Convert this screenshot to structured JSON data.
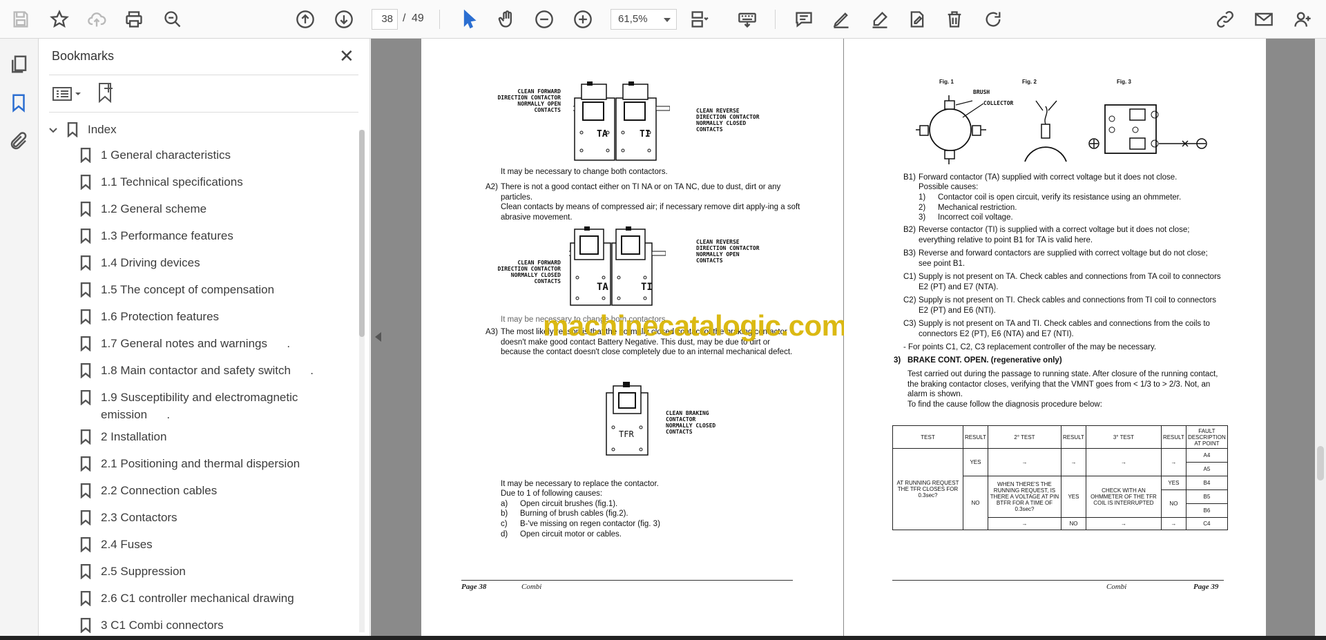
{
  "toolbar": {
    "page_current": "38",
    "page_separator": "/",
    "page_total": "49",
    "zoom": "61,5%"
  },
  "bookmarks": {
    "title": "Bookmarks",
    "root": "Index",
    "items": [
      {
        "label": "1 General characteristics"
      },
      {
        "label": "1.1 Technical specifications"
      },
      {
        "label": "1.2 General scheme"
      },
      {
        "label": "1.3 Performance features"
      },
      {
        "label": "1.4 Driving devices"
      },
      {
        "label": "1.5 The concept of compensation"
      },
      {
        "label": "1.6 Protection features"
      },
      {
        "label": "1.7 General notes and warnings      ."
      },
      {
        "label": "1.8 Main contactor and safety switch      ."
      },
      {
        "label": "1.9 Susceptibility and electromagnetic emission      ."
      },
      {
        "label": "2 Installation"
      },
      {
        "label": "2.1 Positioning and thermal dispersion"
      },
      {
        "label": "2.2 Connection cables"
      },
      {
        "label": "2.3 Contactors"
      },
      {
        "label": "2.4 Fuses"
      },
      {
        "label": "2.5 Suppression"
      },
      {
        "label": "2.6 C1 controller mechanical drawing"
      },
      {
        "label": "3 C1 Combi connectors"
      }
    ]
  },
  "left_page": {
    "diag1_left": "CLEAN FORWARD\nDIRECTION CONTACTOR\nNORMALLY OPEN\nCONTACTS",
    "diag1_right": "CLEAN REVERSE\nDIRECTION CONTACTOR\nNORMALLY CLOSED\nCONTACTS",
    "diag1_ta": "TA",
    "diag1_ti": "TI",
    "p1": "It may be necessary to change both contactors.",
    "a2_label": "A2)",
    "a2_text": "There is not a good contact either on TI NA or on TA NC, due to dust, dirt or any particles.",
    "a2_text2": "Clean contacts by means of compressed air; if necessary remove dirt apply-ing a soft abrasive movement.",
    "diag2_left": "CLEAN FORWARD\nDIRECTION CONTACTOR\nNORMALLY CLOSED\nCONTACTS",
    "diag2_right": "CLEAN REVERSE\nDIRECTION CONTACTOR\nNORMALLY OPEN\nCONTACTS",
    "p2": "It may be necessary to change both contactors.",
    "a3_label": "A3)",
    "a3_text": "The most likely reason is that the normally closed contact of the braking contactor doesn't make good contact Battery Negative. This dust, may be due to dirt or because the contact doesn't close completely due to an internal mechanical defect.",
    "diag3_label": "CLEAN BRAKING\nCONTACTOR\nNORMALLY CLOSED\nCONTACTS",
    "diag3_tfr": "TFR",
    "p3": "It may be necessary to replace the contactor.",
    "p4": "Due to 1 of following causes:",
    "causes": [
      {
        "k": "a)",
        "t": "Open circuit brushes (fig.1)."
      },
      {
        "k": "b)",
        "t": "Burning of brush cables (fig.2)."
      },
      {
        "k": "c)",
        "t": "B-'ve missing on regen contactor (fig. 3)"
      },
      {
        "k": "d)",
        "t": "Open circuit motor or cables."
      }
    ],
    "footer_page": "Page 38",
    "footer_title": "Combi"
  },
  "right_page": {
    "fig1": "Fig. 1",
    "fig2": "Fig. 2",
    "fig3": "Fig. 3",
    "brush": "BRUSH",
    "collector": "COLLECTOR",
    "b1_label": "B1)",
    "b1_text": "Forward contactor (TA) supplied with correct voltage but it does not close.",
    "b1_causes_title": "Possible causes:",
    "b1_causes": [
      {
        "k": "1)",
        "t": "Contactor coil is open circuit, verify its resistance using an ohmmeter."
      },
      {
        "k": "2)",
        "t": "Mechanical restriction."
      },
      {
        "k": "3)",
        "t": "Incorrect coil voltage."
      }
    ],
    "b2_label": "B2)",
    "b2_text": "Reverse contactor (TI) is supplied with a correct voltage but it does not close; everything relative to point B1 for TA is valid here.",
    "b3_label": "B3)",
    "b3_text": "Reverse and forward contactors are supplied with correct voltage but do not close; see point B1.",
    "c1_label": "C1)",
    "c1_text": "Supply is not present on TA. Check cables and connections from TA coil to connectors E2 (PT) and E7 (NTA).",
    "c2_label": "C2)",
    "c2_text": "Supply is not present on TI. Check cables and connections from TI coil to connectors E2 (PT) and E6 (NTI).",
    "c3_label": "C3)",
    "c3_text": "Supply is not present on TA and TI. Check cables and connections from the coils to connectors E2 (PT), E6 (NTA) and E7 (NTI).",
    "c_note": "- For points C1, C2, C3 replacement controller of the may be necessary.",
    "s3_num": "3)",
    "s3_title": "BRAKE CONT. OPEN. (regenerative only)",
    "s3_text": "Test carried out during the passage to running state. After closure of the running contact, the braking contactor closes, verifying that the VMNT goes from < 1/3 to > 2/3. Not, an alarm is shown.",
    "s3_text2": "To find the cause follow the diagnosis procedure below:",
    "table": {
      "h_test": "TEST",
      "h_result": "RESULT",
      "h_test2": "2° TEST",
      "h_result2": "RESULT",
      "h_test3": "3° TEST",
      "h_result3": "RESULT",
      "h_fault": "FAULT DESCRIPTION AT POINT",
      "test1": "AT RUNNING REQUEST THE TFR CLOSES FOR 0.3sec?",
      "yes": "YES",
      "no": "NO",
      "arrow": "→",
      "test2": "WHEN THERE'S THE RUNNING REQUEST, IS THERE A VOLTAGE AT PIN BTFR FOR A TIME OF 0.3sec?",
      "test3": "CHECK WITH AN OHMMETER OF THE TFR COIL IS INTERRUPTED",
      "a4": "A4",
      "a5": "A5",
      "b4": "B4",
      "b5": "B5",
      "b6": "B6",
      "c4": "C4"
    },
    "footer_page": "Page 39",
    "footer_title": "Combi"
  },
  "watermark": "machinecatalogic.com"
}
